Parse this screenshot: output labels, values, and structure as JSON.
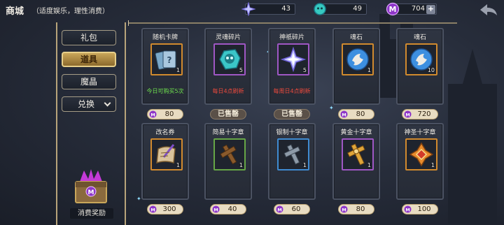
{
  "header": {
    "title": "商城",
    "subtitle": "（适度娱乐，理性消费）",
    "resources": [
      {
        "icon": "star-shard-icon",
        "value": "43"
      },
      {
        "icon": "spirit-orb-icon",
        "value": "49"
      },
      {
        "icon": "purple-gem-icon",
        "value": "704"
      }
    ],
    "plus_label": "+"
  },
  "sidebar": {
    "tabs": [
      {
        "label": "礼包"
      },
      {
        "label": "道具"
      },
      {
        "label": "魔晶"
      },
      {
        "label": "兑换"
      }
    ],
    "active_tab": "道具",
    "reward_label": "消费奖励"
  },
  "items_row1": [
    {
      "name": "随机卡牌",
      "qty": "1",
      "note": "今日可购买5次",
      "price": "80"
    },
    {
      "name": "灵魂碎片",
      "qty": "5",
      "note": "每日4点刷新",
      "status": "已售罄"
    },
    {
      "name": "神祇碎片",
      "qty": "5",
      "note": "每周日4点刷新",
      "status": "已售罄"
    },
    {
      "name": "魂石",
      "qty": "1",
      "price": "80"
    },
    {
      "name": "魂石",
      "qty": "10",
      "price": "720"
    }
  ],
  "items_row2": [
    {
      "name": "改名券",
      "qty": "1",
      "price": "300"
    },
    {
      "name": "简易十字章",
      "qty": "1",
      "price": "40"
    },
    {
      "name": "银制十字章",
      "qty": "1",
      "price": "60"
    },
    {
      "name": "黄金十字章",
      "qty": "1",
      "price": "80"
    },
    {
      "name": "神圣十字章",
      "qty": "1",
      "price": "100"
    }
  ],
  "colors": {
    "rarity_orange": "#d18a2e",
    "rarity_purple": "#9f57c4",
    "rarity_green": "#66a646",
    "rarity_blue": "#3f8bd1",
    "note_green": "#6ee04e",
    "note_red": "#ee4a3c"
  }
}
